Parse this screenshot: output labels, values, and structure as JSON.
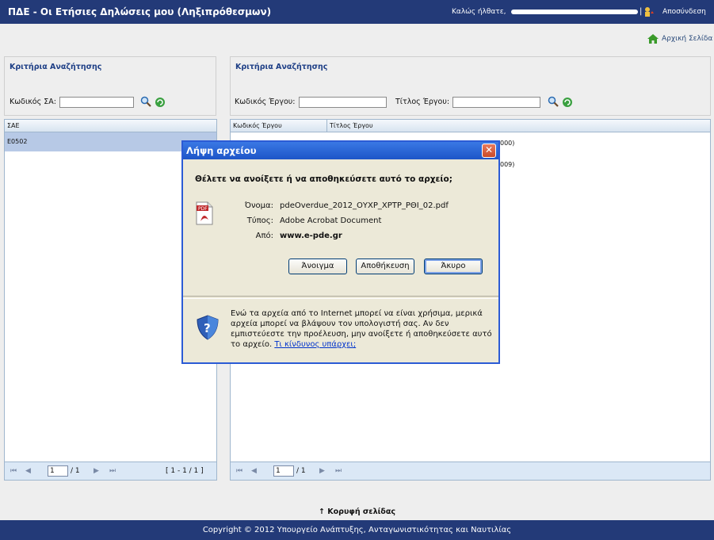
{
  "header": {
    "title": "ΠΔΕ - Οι Ετήσιες Δηλώσεις μου (Ληξιπρόθεσμων)",
    "welcome": "Καλώς ήλθατε,",
    "separator": "|",
    "logout": "Αποσύνδεση"
  },
  "home_link": "Αρχική Σελίδα",
  "left_panel": {
    "title": "Κριτήρια Αναζήτησης",
    "code_label": "Κωδικός ΣΑ:",
    "code_value": ""
  },
  "right_panel": {
    "title": "Κριτήρια Αναζήτησης",
    "project_code_label": "Κωδικός Έργου:",
    "project_code_value": "",
    "project_title_label": "Τίτλος Έργου:",
    "project_title_value": ""
  },
  "left_grid": {
    "columns": [
      "ΣΑΕ"
    ],
    "rows": [
      "Ε0502"
    ],
    "pager": {
      "page": "1",
      "of": "/ 1",
      "range": "[ 1 - 1 / 1 ]"
    }
  },
  "right_grid": {
    "columns": [
      "Κωδικός Έργου",
      "Τίτλος Έργου"
    ],
    "partial_rows": [
      "000)",
      "009)"
    ],
    "pager": {
      "page": "1",
      "of": "/ 1"
    }
  },
  "dialog": {
    "title": "Λήψη αρχείου",
    "close": "✕",
    "question": "Θέλετε να ανοίξετε ή να αποθηκεύσετε αυτό το αρχείο;",
    "name_label": "Όνομα:",
    "name_value": "pdeOverdue_2012_ΟΥΧΡ_ΧΡΤΡ_ΡΘΙ_02.pdf",
    "type_label": "Τύπος:",
    "type_value": "Adobe Acrobat Document",
    "from_label": "Από:",
    "from_value": "www.e-pde.gr",
    "file_icon_text": "PDF",
    "buttons": {
      "open": "Άνοιγμα",
      "save": "Αποθήκευση",
      "cancel": "Άκυρο"
    },
    "warning": "Ενώ τα αρχεία από το Internet μπορεί να είναι χρήσιμα, μερικά αρχεία μπορεί να βλάψουν τον υπολογιστή σας. Αν δεν εμπιστεύεστε την προέλευση, μην ανοίξετε ή αποθηκεύσετε αυτό το αρχείο.",
    "warning_link": "Τι κίνδυνος υπάρχει;"
  },
  "footer": {
    "top_link": "↑ Κορυφή σελίδας",
    "copyright": "Copyright © 2012 Υπουργείο Ανάπτυξης, Ανταγωνιστικότητας και Ναυτιλίας"
  }
}
